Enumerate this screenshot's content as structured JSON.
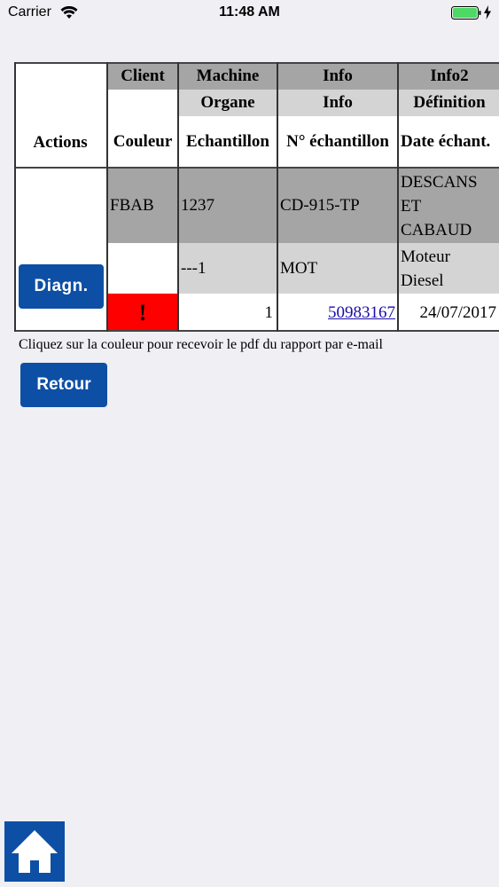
{
  "status_bar": {
    "carrier": "Carrier",
    "time": "11:48 AM"
  },
  "table": {
    "headers": {
      "actions": "Actions",
      "row1": [
        "Client",
        "Machine",
        "Info",
        "Info2"
      ],
      "row2": [
        "",
        "Organe",
        "Info",
        "Définition"
      ],
      "row3": [
        "Couleur",
        "Echantillon",
        "N° échantillon",
        "Date échant."
      ]
    },
    "body": {
      "row1": [
        "FBAB",
        "1237",
        "CD-915-TP",
        "DESCANS",
        "ET",
        "CABAUD"
      ],
      "row2": [
        "",
        "---1",
        "MOT",
        "Moteur",
        "Diesel"
      ],
      "row3": [
        "!",
        "1",
        "50983167",
        "24/07/2017"
      ]
    }
  },
  "actions": {
    "diag_label": "Diagn.",
    "retour_label": "Retour"
  },
  "hint": "Cliquez sur la couleur pour recevoir le pdf du rapport par e-mail",
  "colors": {
    "button_blue": "#0d4fa5",
    "alert_red": "#ff0000",
    "header_dark": "#a5a5a5",
    "header_light": "#d4d4d4"
  },
  "icons": {
    "home": "home-icon",
    "wifi": "wifi-icon",
    "battery": "battery-icon"
  }
}
